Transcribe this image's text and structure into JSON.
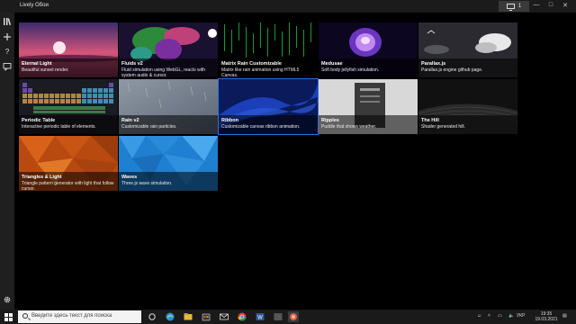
{
  "window": {
    "title": "Lively Обои",
    "screen_label": "1",
    "min": "—",
    "max": "□",
    "close": "✕"
  },
  "rail": {
    "items": [
      "library-icon",
      "add-icon",
      "help-icon",
      "chat-icon"
    ],
    "settings": "gear-icon"
  },
  "tiles": [
    {
      "title": "Eternal Light",
      "desc": "Beautiful sunset render."
    },
    {
      "title": "Fluids v2",
      "desc": "Fluid simulation using WebGL, reacts with system audio & cursor."
    },
    {
      "title": "Matrix Rain Customizable",
      "desc": "Matrix like rain animation using HTML5 Canvas."
    },
    {
      "title": "Medusae",
      "desc": "Soft body jellyfish simulation."
    },
    {
      "title": "Parallax.js",
      "desc": "Parallax.js engine github page."
    },
    {
      "title": "Periodic Table",
      "desc": "Interactive periodic table of elements."
    },
    {
      "title": "Rain v2",
      "desc": "Customizable rain particles."
    },
    {
      "title": "Ribbon",
      "desc": "Customizable canvas ribbon animation."
    },
    {
      "title": "Ripples",
      "desc": "Puddle that shows weather."
    },
    {
      "title": "The Hill",
      "desc": "Shader generated hill."
    },
    {
      "title": "Triangles & Light",
      "desc": "Triangle pattern generator with light that follow cursor."
    },
    {
      "title": "Waves",
      "desc": "Three.js wave simulation."
    }
  ],
  "taskbar": {
    "search_placeholder": "Введите здесь текст для поиска",
    "lang": "УКР",
    "time": "19:35",
    "date": "19.03.2021"
  }
}
